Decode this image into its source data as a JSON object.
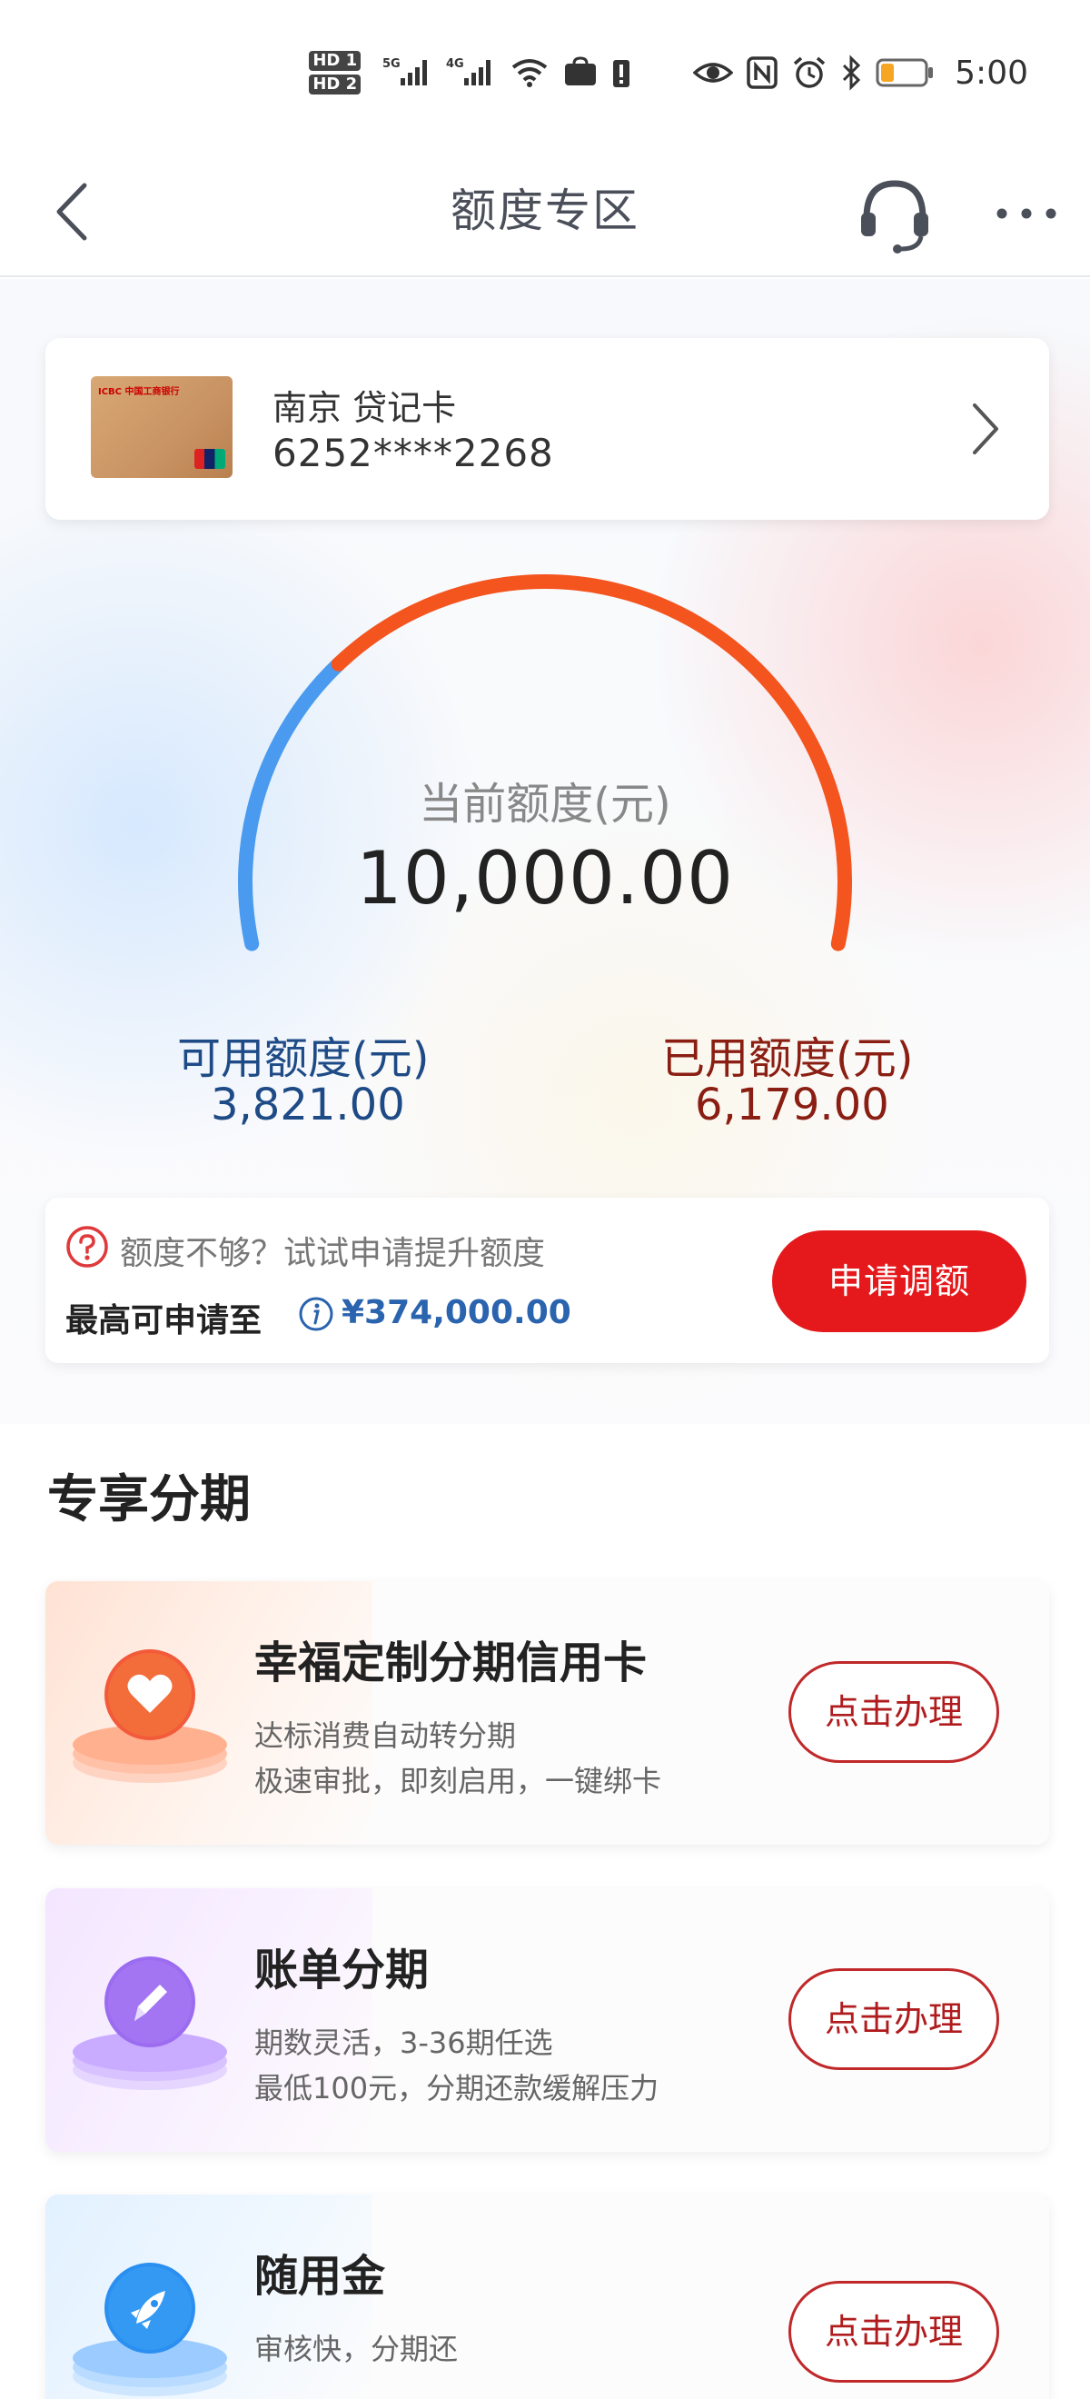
{
  "status_bar": {
    "hd1": "HD 1",
    "hd2": "HD 2",
    "network": "5G",
    "network2": "4G",
    "time": "5:00",
    "icons": [
      "signal-icon",
      "wifi-icon",
      "huawei-icon",
      "alert-icon",
      "eye-icon",
      "nfc-icon",
      "alarm-icon",
      "bluetooth-icon",
      "battery-icon"
    ]
  },
  "nav": {
    "title": "额度专区",
    "icons": [
      "back-chevron-icon",
      "headset-icon",
      "more-icon"
    ]
  },
  "card": {
    "name": "南京 贷记卡",
    "number": "6252****2268",
    "bank_mark": "ICBC 中国工商银行"
  },
  "gauge": {
    "label": "当前额度(元)",
    "total": "10,000.00",
    "used_fraction": 0.6179,
    "colors": {
      "available": "#4a9bf0",
      "used": "#f4541e"
    }
  },
  "available": {
    "label": "可用额度(元)",
    "value": "3,821.00"
  },
  "used": {
    "label": "已用额度(元)",
    "value": "6,179.00"
  },
  "limit": {
    "tip": "额度不够？试试申请提升额度",
    "max_label": "最高可申请至",
    "max_value": "¥374,000.00",
    "apply_button": "申请调额"
  },
  "section": {
    "title": "专享分期"
  },
  "offers": [
    {
      "title": "幸福定制分期信用卡",
      "desc1": "达标消费自动转分期",
      "desc2": "极速审批，即刻启用，一键绑卡",
      "button": "点击办理",
      "icon": "heart-icon",
      "color": "#f25a3a"
    },
    {
      "title": "账单分期",
      "desc1": "期数灵活，3-36期任选",
      "desc2": "最低100元，分期还款缓解压力",
      "button": "点击办理",
      "icon": "pencil-icon",
      "color": "#9b6cf0"
    },
    {
      "title": "随用金",
      "desc1": "审核快，分期还",
      "desc2": "",
      "button": "点击办理",
      "icon": "rocket-icon",
      "color": "#2a8ff0"
    }
  ]
}
